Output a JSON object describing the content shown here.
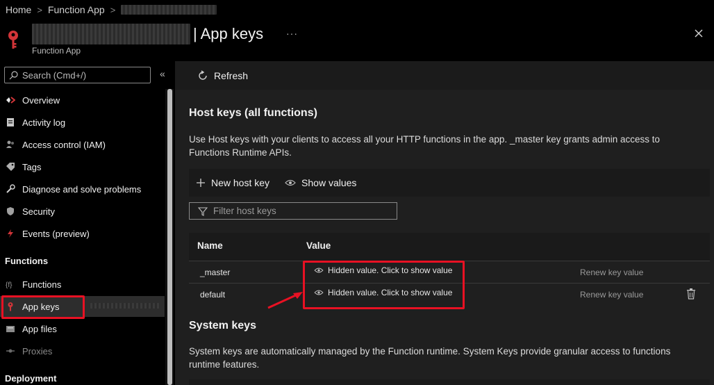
{
  "breadcrumb": {
    "home": "Home",
    "function_app": "Function App"
  },
  "resource": {
    "type": "Function App",
    "title": "| App keys",
    "more": "···"
  },
  "colors": {
    "accent_red": "#e81123",
    "key_icon": "#d13438"
  },
  "sidebar": {
    "search_placeholder": "Search (Cmd+/)",
    "collapse": "«",
    "items": [
      {
        "label": "Overview",
        "icon": "overview-icon"
      },
      {
        "label": "Activity log",
        "icon": "activity-log-icon"
      },
      {
        "label": "Access control (IAM)",
        "icon": "people-icon"
      },
      {
        "label": "Tags",
        "icon": "tag-icon"
      },
      {
        "label": "Diagnose and solve problems",
        "icon": "wrench-icon"
      },
      {
        "label": "Security",
        "icon": "shield-icon"
      },
      {
        "label": "Events (preview)",
        "icon": "lightning-icon"
      }
    ],
    "section_functions": "Functions",
    "functions_items": [
      {
        "label": "Functions",
        "icon": "function-icon"
      },
      {
        "label": "App keys",
        "icon": "key-icon",
        "active": true
      },
      {
        "label": "App files",
        "icon": "files-icon"
      },
      {
        "label": "Proxies",
        "icon": "proxies-icon",
        "disabled": true
      }
    ],
    "section_deployment": "Deployment"
  },
  "toolbar": {
    "refresh": "Refresh"
  },
  "host_keys": {
    "heading": "Host keys (all functions)",
    "description": "Use Host keys with your clients to access all your HTTP functions in the app. _master key grants admin access to Functions Runtime APIs.",
    "new_key": "New host key",
    "show_values": "Show values",
    "filter_placeholder": "Filter host keys",
    "columns": {
      "name": "Name",
      "value": "Value"
    },
    "rows": [
      {
        "name": "_master",
        "value": "Hidden value. Click to show value",
        "action": "Renew key value"
      },
      {
        "name": "default",
        "value": "Hidden value. Click to show value",
        "action": "Renew key value"
      }
    ]
  },
  "system_keys": {
    "heading": "System keys",
    "description": "System keys are automatically managed by the Function runtime. System Keys provide granular access to functions runtime features."
  }
}
